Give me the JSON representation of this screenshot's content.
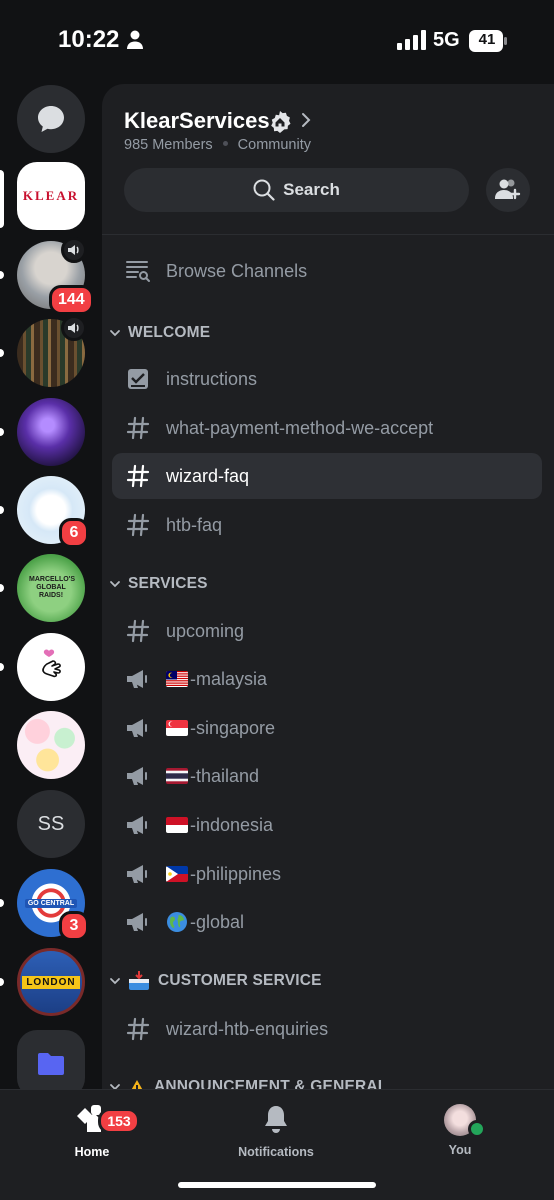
{
  "status_bar": {
    "time": "10:22",
    "network": "5G",
    "battery": "41"
  },
  "rail": {
    "servers": [
      {
        "name": "Direct Messages",
        "type": "dm"
      },
      {
        "name": "KLEAR",
        "logo_text": "KLEAR",
        "active": true
      },
      {
        "name": "voice server 1",
        "badge": "144",
        "voice": true,
        "unread": true
      },
      {
        "name": "bookshelf server",
        "voice": true,
        "unread": true
      },
      {
        "name": "purple server",
        "unread": true
      },
      {
        "name": "cinnamoroll server",
        "badge": "6",
        "unread": true
      },
      {
        "name": "Marcello's Global Raids",
        "logo_text": "MARCELLO'S GLOBAL RAIDS!",
        "unread": true
      },
      {
        "name": "finger heart server",
        "unread": true
      },
      {
        "name": "cute stickers server"
      },
      {
        "name": "SS",
        "logo_text": "SS"
      },
      {
        "name": "GO Central",
        "logo_text": "GO CENTRAL",
        "badge": "3",
        "unread": true
      },
      {
        "name": "Pokemon GO London",
        "logo_text": "LONDON",
        "unread": true
      },
      {
        "name": "folder"
      }
    ]
  },
  "server": {
    "name": "KlearServices",
    "members": "985 Members",
    "community": "Community",
    "search_label": "Search"
  },
  "browse_label": "Browse Channels",
  "categories": {
    "welcome": "WELCOME",
    "services": "SERVICES",
    "customer_service": "CUSTOMER SERVICE",
    "announcement": "ANNOUNCEMENT & GENERAL"
  },
  "channels": {
    "welcome": [
      "instructions",
      "what-payment-method-we-accept",
      "wizard-faq",
      "htb-faq"
    ],
    "services": [
      "upcoming",
      "-malaysia",
      "-singapore",
      "-thailand",
      "-indonesia",
      "-philippines",
      "-global"
    ],
    "customer_service": [
      "wizard-htb-enquiries"
    ]
  },
  "selected_channel": "wizard-faq",
  "nav": {
    "home_label": "Home",
    "home_badge": "153",
    "notifications_label": "Notifications",
    "you_label": "You"
  },
  "colors": {
    "accent": "#5865f2",
    "badge": "#f23f43",
    "online": "#23a55a",
    "panel": "#1e1f22"
  }
}
